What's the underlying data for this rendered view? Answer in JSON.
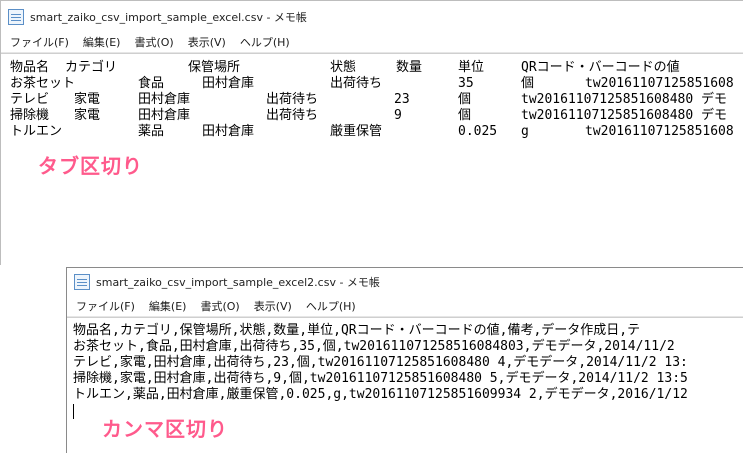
{
  "window1": {
    "title": "smart_zaiko_csv_import_sample_excel.csv - メモ帳",
    "menu": [
      "ファイル(F)",
      "編集(E)",
      "書式(O)",
      "表示(V)",
      "ヘルプ(H)"
    ],
    "rows": [
      [
        "物品名",
        "カテゴリ",
        "保管場所",
        "状態",
        "数量",
        "単位",
        "QRコード・バーコードの値"
      ],
      [
        "お茶セット",
        "食品",
        "田村倉庫",
        "出荷待ち",
        "35",
        "個",
        "tw20161107125851608"
      ],
      [
        "テレビ",
        "家電",
        "田村倉庫",
        "出荷待ち",
        "23",
        "個",
        "tw20161107125851608480 デモ"
      ],
      [
        "掃除機",
        "家電",
        "田村倉庫",
        "出荷待ち",
        "9",
        "個",
        "tw20161107125851608480 デモ"
      ],
      [
        "トルエン",
        "薬品",
        "田村倉庫",
        "厳重保管",
        "0.025",
        "g",
        "tw20161107125851608"
      ]
    ]
  },
  "window2": {
    "title": "smart_zaiko_csv_import_sample_excel2.csv - メモ帳",
    "menu": [
      "ファイル(F)",
      "編集(E)",
      "書式(O)",
      "表示(V)",
      "ヘルプ(H)"
    ],
    "lines": [
      "物品名,カテゴリ,保管場所,状態,数量,単位,QRコード・バーコードの値,備考,データ作成日,テ",
      "お茶セット,食品,田村倉庫,出荷待ち,35,個,tw20161107125851608480З,デモデータ,2014/11/2",
      "テレビ,家電,田村倉庫,出荷待ち,23,個,tw20161107125851608480 4,デモデータ,2014/11/2 13:",
      "掃除機,家電,田村倉庫,出荷待ち,9,個,tw20161107125851608480 5,デモデータ,2014/11/2 13:5",
      "トルエン,薬品,田村倉庫,厳重保管,0.025,g,tw20161107125851609934 2,デモデータ,2016/1/12"
    ]
  },
  "annotations": {
    "tab": "タブ区切り",
    "comma": "カンマ区切り",
    "color": "#ff5a8c"
  }
}
